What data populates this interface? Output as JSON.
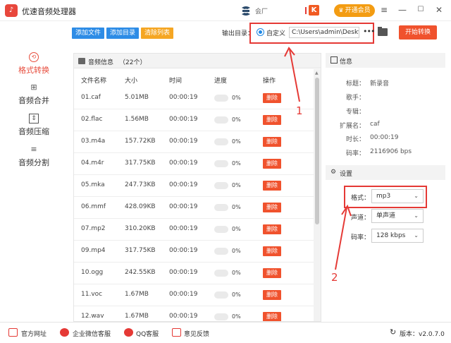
{
  "app": {
    "title": "优速音频处理器",
    "logo_text": "♪"
  },
  "titlebar": {
    "member_text": "会厂",
    "vip_label": "开通会员",
    "menu_icon": "≡",
    "min_icon": "—",
    "max_icon": "☐",
    "close_icon": "✕"
  },
  "nav": [
    {
      "label": "格式转换",
      "icon": "⟲",
      "active": true
    },
    {
      "label": "音频合并",
      "icon": "⊞"
    },
    {
      "label": "音频压缩",
      "icon": "⇕"
    },
    {
      "label": "音频分割",
      "icon": "≡"
    }
  ],
  "toolbar": {
    "add_file": "添加文件",
    "add_dir": "添加目录",
    "clear_list": "清除列表",
    "output_label": "输出目录：",
    "custom_label": "自定义",
    "path_value": "C:\\Users\\admin\\Deskto",
    "more": "•••",
    "start": "开始转换",
    "colors": {
      "blue": "#2d8ce6",
      "orange": "#f5a623",
      "red": "#f0522d"
    }
  },
  "filelist": {
    "title": "音频信息",
    "count": "（22个）",
    "columns": [
      "文件名称",
      "大小",
      "时间",
      "进度",
      "操作"
    ],
    "delete_label": "删除",
    "rows": [
      {
        "name": "01.caf",
        "size": "5.01MB",
        "time": "00:00:19",
        "progress": "0%"
      },
      {
        "name": "02.flac",
        "size": "1.56MB",
        "time": "00:00:19",
        "progress": "0%"
      },
      {
        "name": "03.m4a",
        "size": "157.72KB",
        "time": "00:00:19",
        "progress": "0%"
      },
      {
        "name": "04.m4r",
        "size": "317.75KB",
        "time": "00:00:19",
        "progress": "0%"
      },
      {
        "name": "05.mka",
        "size": "247.73KB",
        "time": "00:00:19",
        "progress": "0%"
      },
      {
        "name": "06.mmf",
        "size": "428.09KB",
        "time": "00:00:19",
        "progress": "0%"
      },
      {
        "name": "07.mp2",
        "size": "310.20KB",
        "time": "00:00:19",
        "progress": "0%"
      },
      {
        "name": "09.mp4",
        "size": "317.75KB",
        "time": "00:00:19",
        "progress": "0%"
      },
      {
        "name": "10.ogg",
        "size": "242.55KB",
        "time": "00:00:19",
        "progress": "0%"
      },
      {
        "name": "11.voc",
        "size": "1.67MB",
        "time": "00:00:19",
        "progress": "0%"
      },
      {
        "name": "12.wav",
        "size": "1.67MB",
        "time": "00:00:19",
        "progress": "0%"
      }
    ]
  },
  "info": {
    "title": "信息",
    "fields": [
      {
        "k": "标题：",
        "v": "新录音"
      },
      {
        "k": "歌手：",
        "v": ""
      },
      {
        "k": "专辑：",
        "v": ""
      },
      {
        "k": "扩展名：",
        "v": "caf"
      },
      {
        "k": "时长：",
        "v": "00:00:19"
      },
      {
        "k": "码率：",
        "v": "2116906 bps"
      }
    ]
  },
  "settings": {
    "title": "设置",
    "format_label": "格式：",
    "format_value": "mp3",
    "channel_label": "声道：",
    "channel_value": "单声道",
    "bitrate_label": "码率：",
    "bitrate_value": "128 kbps"
  },
  "annotations": {
    "one": "1",
    "two": "2"
  },
  "footer": {
    "website": "官方网址",
    "wechat": "企业微信客服",
    "qq": "QQ客服",
    "feedback": "意见反馈",
    "version": "版本：v2.0.7.0"
  }
}
